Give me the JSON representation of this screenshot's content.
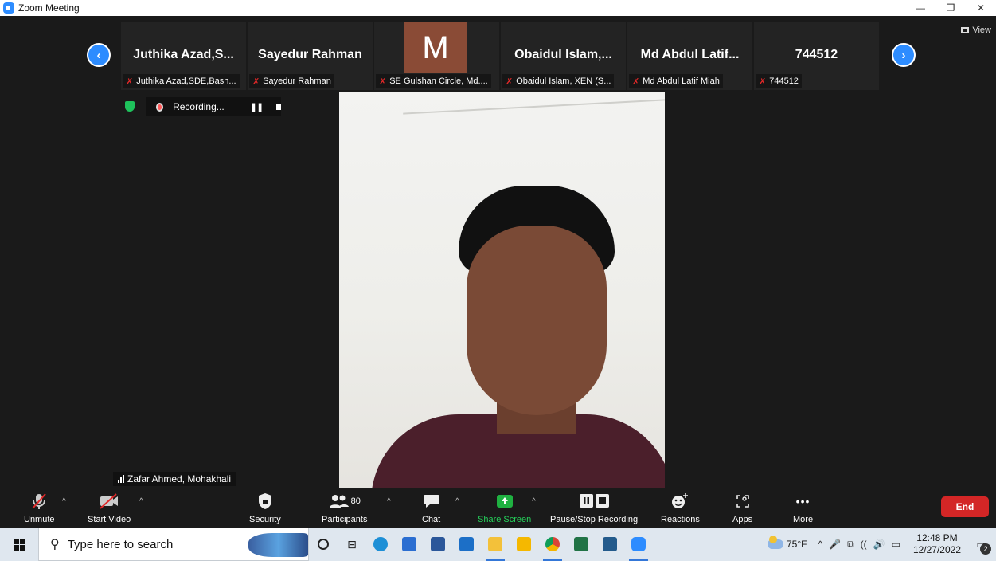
{
  "window": {
    "title": "Zoom Meeting",
    "controls": {
      "minimize": "—",
      "restore": "❐",
      "close": "✕"
    }
  },
  "meeting": {
    "view_label": "View",
    "nav": {
      "prev": "‹",
      "next": "›"
    },
    "thumbnails": [
      {
        "name": "Juthika  Azad,S...",
        "label": "Juthika Azad,SDE,Bash...",
        "muted": true
      },
      {
        "name": "Sayedur Rahman",
        "label": "Sayedur Rahman",
        "muted": true
      },
      {
        "avatar_letter": "M",
        "label": "SE Gulshan Circle, Md....",
        "muted": true,
        "avatar_color": "#8a4b36"
      },
      {
        "name": "Obaidul  Islam,...",
        "label": "Obaidul Islam, XEN (S...",
        "muted": true
      },
      {
        "name": "Md Abdul Latif...",
        "label": "Md Abdul Latif Miah",
        "muted": true
      },
      {
        "name": "744512",
        "label": "744512",
        "muted": true
      }
    ],
    "recording": {
      "text": "Recording...",
      "pause_icon": "❚❚"
    },
    "speaker": {
      "name": "Zafar Ahmed, Mohakhali"
    }
  },
  "toolbar": {
    "unmute": "Unmute",
    "start_video": "Start Video",
    "security": "Security",
    "participants": "Participants",
    "participants_count": "80",
    "chat": "Chat",
    "share_screen": "Share Screen",
    "pause_stop_recording": "Pause/Stop Recording",
    "reactions": "Reactions",
    "apps": "Apps",
    "more": "More",
    "more_icon": "•••",
    "end": "End",
    "caret": "^",
    "colors": {
      "share_green": "#1fb141",
      "end_red": "#d32626",
      "accent_blue": "#2d8cff"
    }
  },
  "taskbar": {
    "search_placeholder": "Type here to search",
    "weather_temp": "75°F",
    "time": "12:48 PM",
    "date": "12/27/2022",
    "notification_count": "2",
    "tray_icons": [
      "^",
      "🎤",
      "⧉",
      "((",
      "🔊",
      "▭"
    ]
  }
}
